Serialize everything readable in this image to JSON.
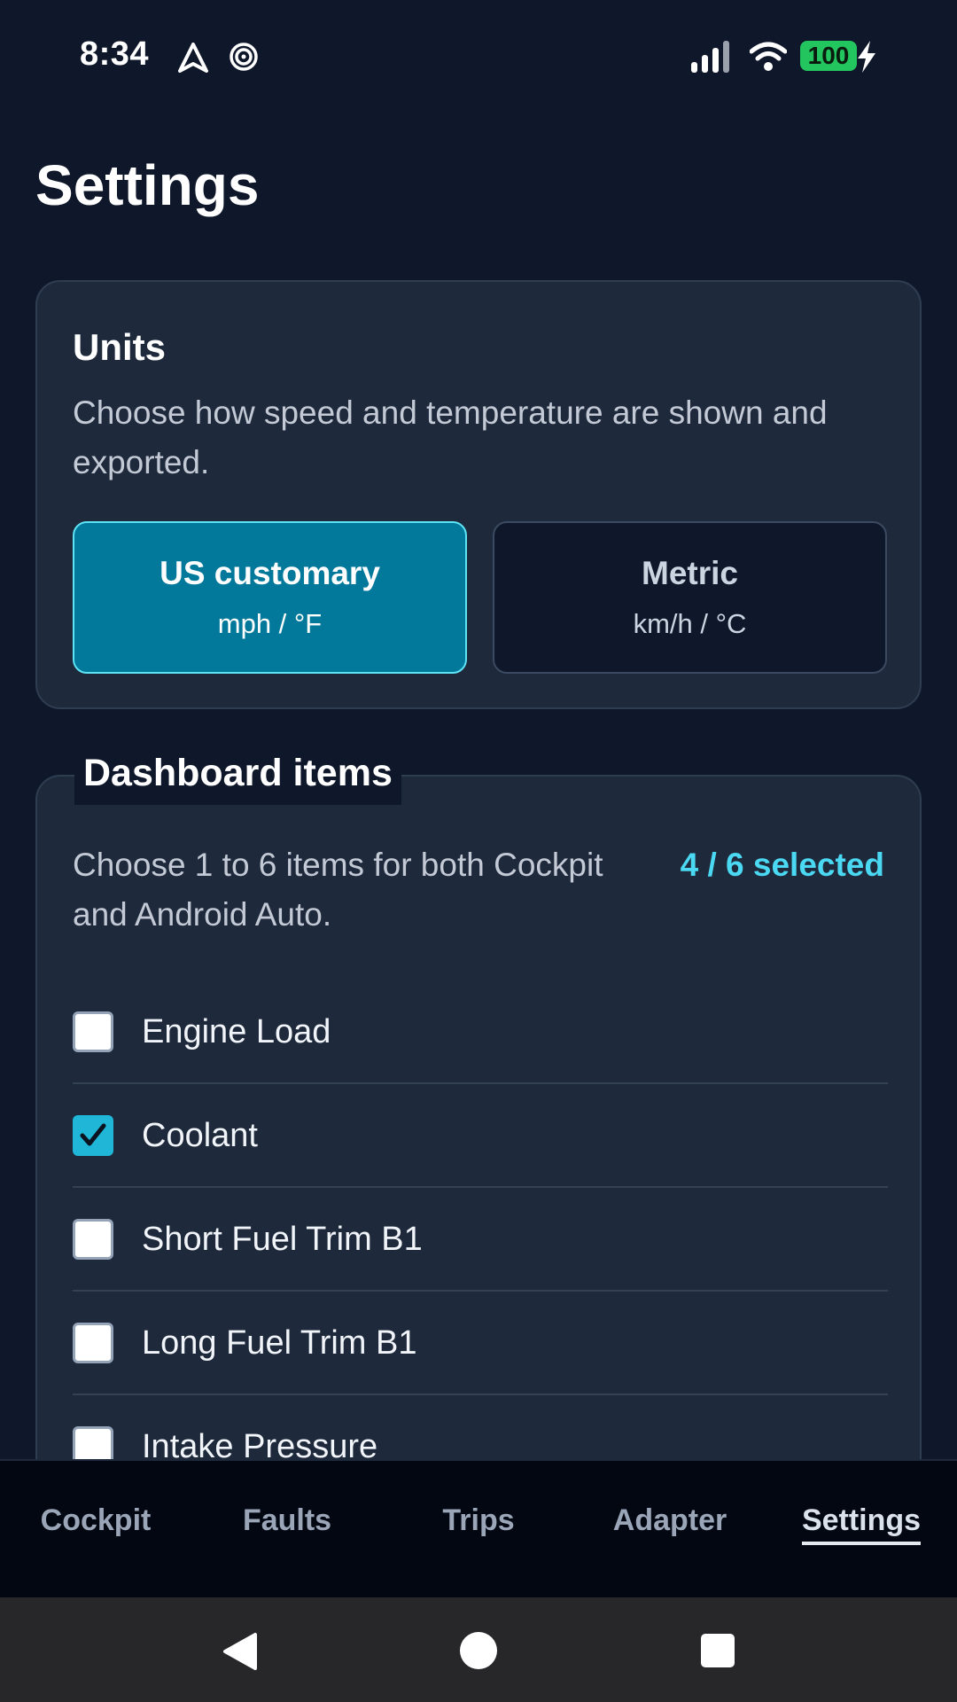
{
  "status_bar": {
    "time": "8:34",
    "battery": "100",
    "icons": [
      "navigation-arrow-icon",
      "hotspot-icon",
      "signal-icon",
      "wifi-icon",
      "battery-icon",
      "charging-bolt-icon"
    ]
  },
  "page": {
    "title": "Settings"
  },
  "units": {
    "title": "Units",
    "description": "Choose how speed and temperature are shown and exported.",
    "options": [
      {
        "name": "US customary",
        "sub": "mph / °F",
        "selected": true
      },
      {
        "name": "Metric",
        "sub": "km/h / °C",
        "selected": false
      }
    ]
  },
  "dashboard": {
    "title": "Dashboard items",
    "description": "Choose 1 to 6 items for both Cockpit and Android Auto.",
    "count_label": "4 / 6 selected",
    "items": [
      {
        "label": "Engine Load",
        "checked": false
      },
      {
        "label": "Coolant",
        "checked": true
      },
      {
        "label": "Short Fuel Trim B1",
        "checked": false
      },
      {
        "label": "Long Fuel Trim B1",
        "checked": false
      },
      {
        "label": "Intake Pressure",
        "checked": false
      }
    ]
  },
  "nav": {
    "tabs": [
      {
        "label": "Cockpit",
        "active": false
      },
      {
        "label": "Faults",
        "active": false
      },
      {
        "label": "Trips",
        "active": false
      },
      {
        "label": "Adapter",
        "active": false
      },
      {
        "label": "Settings",
        "active": true
      }
    ]
  },
  "system_nav": {
    "buttons": [
      "back-icon",
      "home-icon",
      "recents-icon"
    ]
  },
  "colors": {
    "background": "#0f172a",
    "card": "#1e293b",
    "accent": "#02799b",
    "accent_text": "#4ad8f2",
    "battery": "#22c55e"
  }
}
